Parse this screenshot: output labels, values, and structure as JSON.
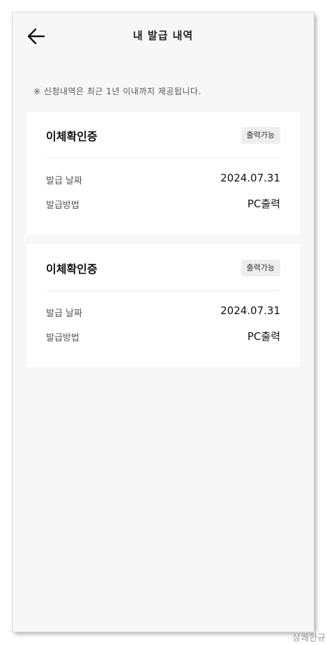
{
  "header": {
    "title": "내 발급 내역",
    "back_icon": "arrow-left-icon"
  },
  "notice": "※ 신청내역은 최근 1년 이내까지 제공됩니다.",
  "cards": [
    {
      "title": "이체확인증",
      "badge": "출력가능",
      "rows": [
        {
          "label": "발급 날짜",
          "value": "2024.07.31"
        },
        {
          "label": "발급방법",
          "value": "PC출력"
        }
      ]
    },
    {
      "title": "이체확인증",
      "badge": "출력가능",
      "rows": [
        {
          "label": "발급 날짜",
          "value": "2024.07.31"
        },
        {
          "label": "발급방법",
          "value": "PC출력"
        }
      ]
    }
  ],
  "watermark": "상쾌한규"
}
